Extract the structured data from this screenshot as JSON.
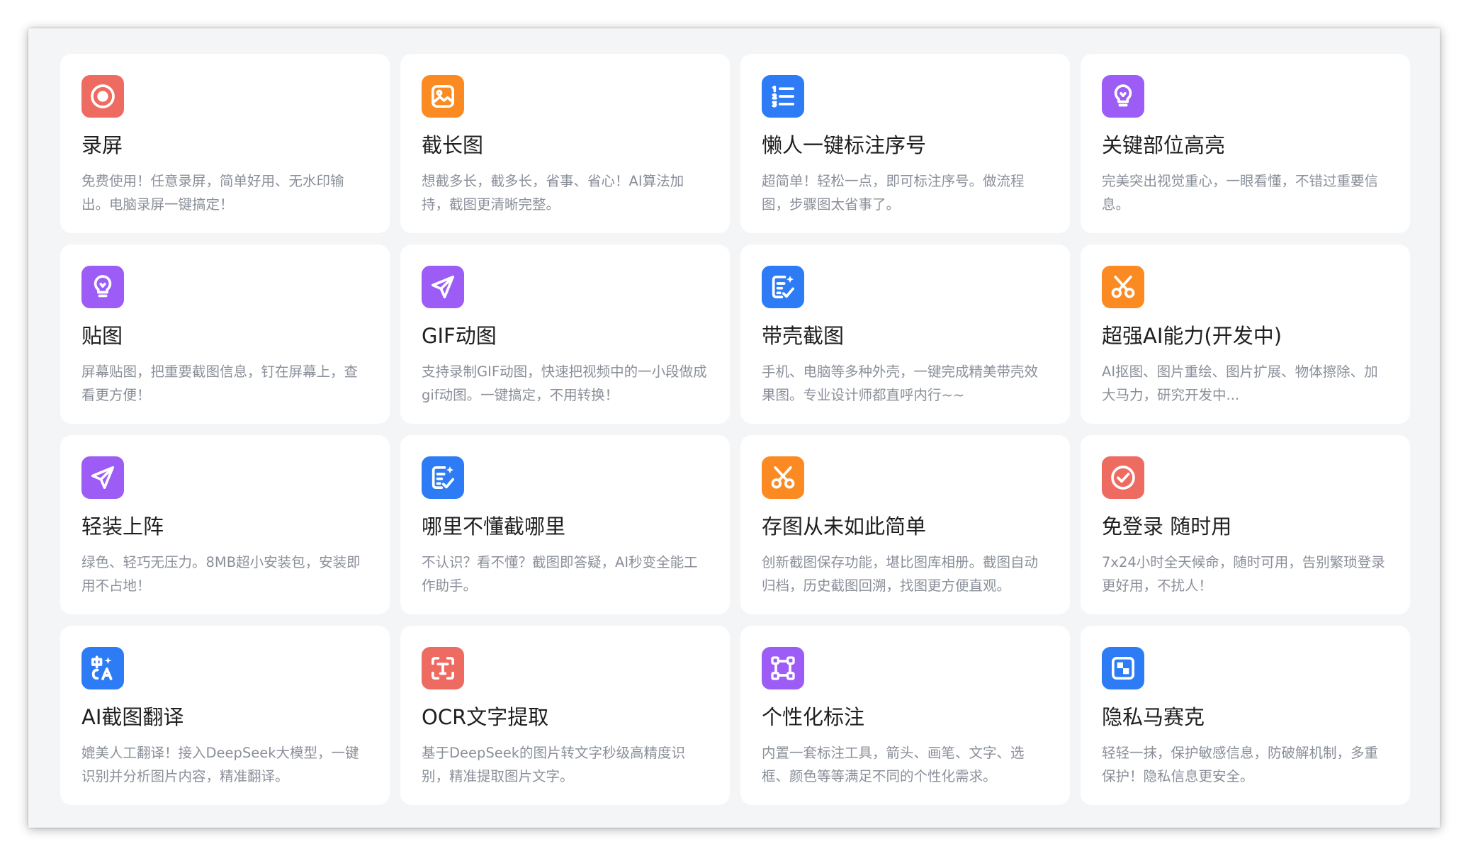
{
  "colors": {
    "red": "#ee6b62",
    "orange": "#fb8a22",
    "blue": "#2d7cf6",
    "purple": "#9c5cf5"
  },
  "cards": [
    {
      "title": "录屏",
      "desc": "免费使用！任意录屏，简单好用、无水印输出。电脑录屏一键搞定！",
      "icon": "record-icon",
      "color": "#ee6b62"
    },
    {
      "title": "截长图",
      "desc": "想截多长，截多长，省事、省心！AI算法加持，截图更清晰完整。",
      "icon": "image-icon",
      "color": "#fb8a22"
    },
    {
      "title": "懒人一键标注序号",
      "desc": "超简单！轻松一点，即可标注序号。做流程图，步骤图太省事了。",
      "icon": "numbered-list-icon",
      "color": "#2d7cf6"
    },
    {
      "title": "关键部位高亮",
      "desc": "完美突出视觉重心，一眼看懂，不错过重要信息。",
      "icon": "lightbulb-icon",
      "color": "#9c5cf5"
    },
    {
      "title": "贴图",
      "desc": "屏幕贴图，把重要截图信息，钉在屏幕上，查看更方便！",
      "icon": "lightbulb-icon",
      "color": "#9c5cf5"
    },
    {
      "title": "GIF动图",
      "desc": "支持录制GIF动图，快速把视频中的一小段做成gif动图。一键搞定，不用转换！",
      "icon": "send-icon",
      "color": "#9c5cf5"
    },
    {
      "title": "带壳截图",
      "desc": "手机、电脑等多种外壳，一键完成精美带壳效果图。专业设计师都直呼内行~~",
      "icon": "edit-sparkle-icon",
      "color": "#2d7cf6"
    },
    {
      "title": "超强AI能力(开发中)",
      "desc": "AI抠图、图片重绘、图片扩展、物体擦除、加大马力，研究开发中...",
      "icon": "scissors-icon",
      "color": "#fb8a22"
    },
    {
      "title": "轻装上阵",
      "desc": "绿色、轻巧无压力。8MB超小安装包，安装即用不占地！",
      "icon": "send-icon",
      "color": "#9c5cf5"
    },
    {
      "title": "哪里不懂截哪里",
      "desc": "不认识？看不懂？截图即答疑，AI秒变全能工作助手。",
      "icon": "edit-sparkle-icon",
      "color": "#2d7cf6"
    },
    {
      "title": "存图从未如此简单",
      "desc": "创新截图保存功能，堪比图库相册。截图自动归档，历史截图回溯，找图更方便直观。",
      "icon": "scissors-icon",
      "color": "#fb8a22"
    },
    {
      "title": "免登录 随时用",
      "desc": "7x24小时全天候命，随时可用，告别繁琐登录更好用，不扰人！",
      "icon": "check-circle-icon",
      "color": "#ee6b62"
    },
    {
      "title": "AI截图翻译",
      "desc": "媲美人工翻译！接入DeepSeek大模型，一键识别并分析图片内容，精准翻译。",
      "icon": "translate-icon",
      "color": "#2d7cf6"
    },
    {
      "title": "OCR文字提取",
      "desc": "基于DeepSeek的图片转文字秒级高精度识别，精准提取图片文字。",
      "icon": "text-scan-icon",
      "color": "#ee6b62"
    },
    {
      "title": "个性化标注",
      "desc": "内置一套标注工具，箭头、画笔、文字、选框、颜色等等满足不同的个性化需求。",
      "icon": "frame-icon",
      "color": "#9c5cf5"
    },
    {
      "title": "隐私马赛克",
      "desc": "轻轻一抹，保护敏感信息，防破解机制，多重保护！隐私信息更安全。",
      "icon": "mosaic-icon",
      "color": "#2d7cf6"
    }
  ]
}
